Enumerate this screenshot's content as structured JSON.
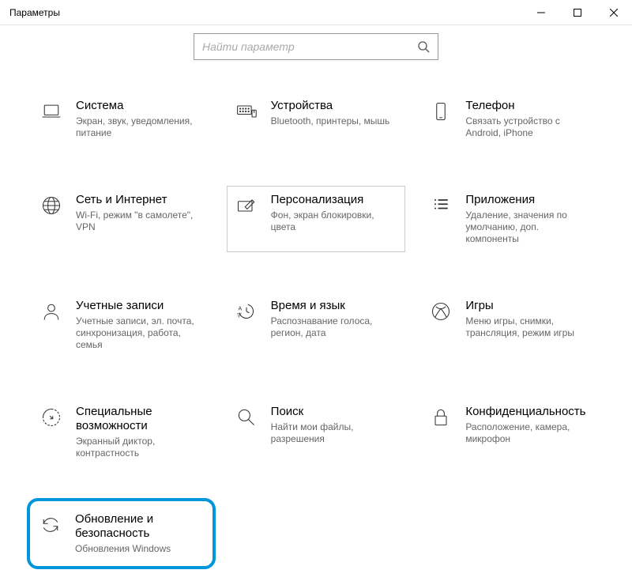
{
  "window": {
    "title": "Параметры"
  },
  "search": {
    "placeholder": "Найти параметр"
  },
  "tiles": [
    {
      "id": "system",
      "title": "Система",
      "desc": "Экран, звук, уведомления, питание"
    },
    {
      "id": "devices",
      "title": "Устройства",
      "desc": "Bluetooth, принтеры, мышь"
    },
    {
      "id": "phone",
      "title": "Телефон",
      "desc": "Связать устройство с Android, iPhone"
    },
    {
      "id": "network",
      "title": "Сеть и Интернет",
      "desc": "Wi-Fi, режим \"в самолете\", VPN"
    },
    {
      "id": "personalization",
      "title": "Персонализация",
      "desc": "Фон, экран блокировки, цвета"
    },
    {
      "id": "apps",
      "title": "Приложения",
      "desc": "Удаление, значения по умолчанию, доп. компоненты"
    },
    {
      "id": "accounts",
      "title": "Учетные записи",
      "desc": "Учетные записи, эл. почта, синхронизация, работа, семья"
    },
    {
      "id": "time",
      "title": "Время и язык",
      "desc": "Распознавание голоса, регион, дата"
    },
    {
      "id": "gaming",
      "title": "Игры",
      "desc": "Меню игры, снимки, трансляция, режим игры"
    },
    {
      "id": "ease",
      "title": "Специальные возможности",
      "desc": "Экранный диктор, контрастность"
    },
    {
      "id": "search-tile",
      "title": "Поиск",
      "desc": "Найти мои файлы, разрешения"
    },
    {
      "id": "privacy",
      "title": "Конфиденциальность",
      "desc": "Расположение, камера, микрофон"
    },
    {
      "id": "update",
      "title": "Обновление и безопасность",
      "desc": "Обновления Windows"
    }
  ]
}
